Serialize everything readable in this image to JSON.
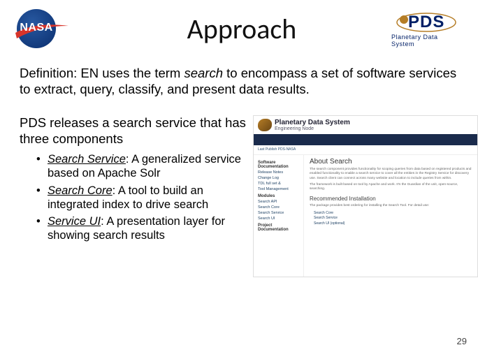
{
  "header": {
    "nasa_text": "NASA",
    "title": "Approach",
    "pds_text": "PDS",
    "pds_sub": "Planetary Data System"
  },
  "definition": {
    "prefix": "Definition: EN uses the term ",
    "italic": "search",
    "suffix": " to encompass a set of software services to extract, query, classify, and present data results."
  },
  "intro": "PDS releases a search service that has three components",
  "bullets": [
    {
      "title": "Search Service",
      "body": ": A generalized service based on Apache Solr"
    },
    {
      "title": "Search Core",
      "body": ": A tool to build an integrated index to drive search"
    },
    {
      "title": "Service UI",
      "body": ": A presentation layer for showing search results"
    }
  ],
  "thumb": {
    "site_title": "Planetary Data System",
    "site_sub": "Engineering Node",
    "breadcrumb": "Last Publish PDS-NASA",
    "sidebar": {
      "g1": "Software Documentation",
      "i1": "Release Notes",
      "i2": "Change Log",
      "i3": "TDL full set &",
      "i4": "Tool Management",
      "g2": "Modules",
      "i5": "Search API",
      "i6": "Search Core",
      "i7": "Search Service",
      "i8": "Search UI",
      "g3": "Project Documentation"
    },
    "main": {
      "h1": "About Search",
      "p1": "The search component provides functionality for scoping queries from data based on registered products and enabled functionality to enable a search service to cover all the entities in the Registry Service for discovery use. Search client can connect across many website and location to include queries from within.",
      "p2": "The framework is built based on tool by Apache and work. It's the Guardian of the unit, open-source, searching.",
      "h2": "Recommended Installation",
      "p3": "The package provides best ordering for installing the Search Tool. For detail use:",
      "li1": "Search Core",
      "li2": "Search Service",
      "li3": "Search UI (optional)"
    }
  },
  "page_number": "29"
}
